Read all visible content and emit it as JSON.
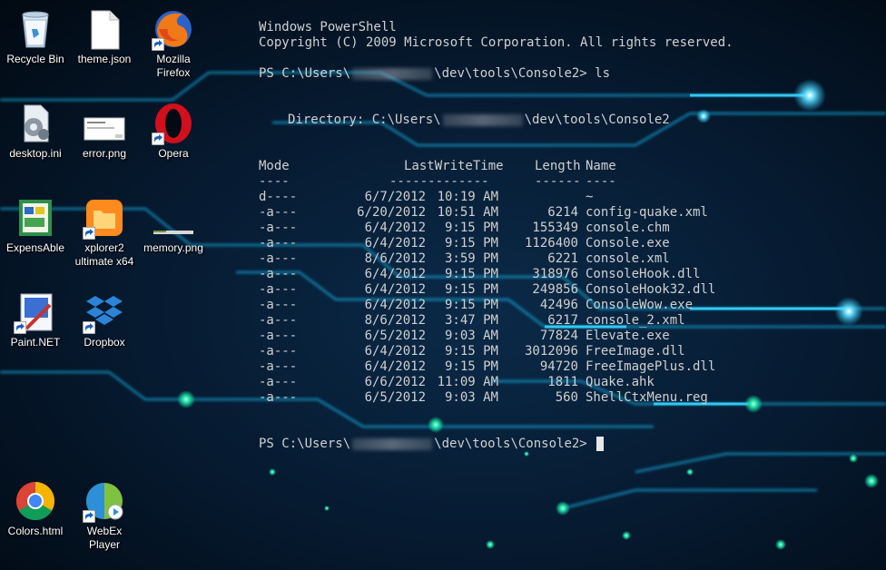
{
  "desktop": {
    "icons": [
      {
        "label": "Recycle Bin",
        "icon": "recycle-bin-icon"
      },
      {
        "label": "theme.json",
        "icon": "file-icon"
      },
      {
        "label": "Mozilla Firefox",
        "icon": "firefox-icon"
      },
      {
        "label": "desktop.ini",
        "icon": "settings-file-icon"
      },
      {
        "label": "error.png",
        "icon": "image-file-icon"
      },
      {
        "label": "Opera",
        "icon": "opera-icon"
      },
      {
        "label": "ExpensAble",
        "icon": "expensable-icon"
      },
      {
        "label": "xplorer2 ultimate x64",
        "icon": "xplorer2-icon"
      },
      {
        "label": "memory.png",
        "icon": "image-file-icon"
      },
      {
        "label": "Paint.NET",
        "icon": "paint-net-icon"
      },
      {
        "label": "Dropbox",
        "icon": "dropbox-icon"
      },
      {
        "label": "Colors.html",
        "icon": "chrome-icon"
      },
      {
        "label": "WebEx Player",
        "icon": "webex-player-icon"
      }
    ]
  },
  "console": {
    "header_title": "Windows PowerShell",
    "header_copyright": "Copyright (C) 2009 Microsoft Corporation. All rights reserved.",
    "prompt_prefix": "PS C:\\Users\\",
    "prompt_suffix": "\\dev\\tools\\Console2>",
    "command": "ls",
    "directory_prefix": "Directory: C:\\Users\\",
    "directory_suffix": "\\dev\\tools\\Console2",
    "columns": {
      "mode": "Mode",
      "time": "LastWriteTime",
      "length": "Length",
      "name": "Name"
    },
    "separators": {
      "mode": "----",
      "time": "-------------",
      "length": "------",
      "name": "----"
    },
    "rows": [
      {
        "mode": "d----",
        "date": "6/7/2012",
        "time": "10:19 AM",
        "length": "",
        "name": "~"
      },
      {
        "mode": "-a---",
        "date": "6/20/2012",
        "time": "10:51 AM",
        "length": "6214",
        "name": "config-quake.xml"
      },
      {
        "mode": "-a---",
        "date": "6/4/2012",
        "time": "9:15 PM",
        "length": "155349",
        "name": "console.chm"
      },
      {
        "mode": "-a---",
        "date": "6/4/2012",
        "time": "9:15 PM",
        "length": "1126400",
        "name": "Console.exe"
      },
      {
        "mode": "-a---",
        "date": "8/6/2012",
        "time": "3:59 PM",
        "length": "6221",
        "name": "console.xml"
      },
      {
        "mode": "-a---",
        "date": "6/4/2012",
        "time": "9:15 PM",
        "length": "318976",
        "name": "ConsoleHook.dll"
      },
      {
        "mode": "-a---",
        "date": "6/4/2012",
        "time": "9:15 PM",
        "length": "249856",
        "name": "ConsoleHook32.dll"
      },
      {
        "mode": "-a---",
        "date": "6/4/2012",
        "time": "9:15 PM",
        "length": "42496",
        "name": "ConsoleWow.exe"
      },
      {
        "mode": "-a---",
        "date": "8/6/2012",
        "time": "3:47 PM",
        "length": "6217",
        "name": "console_2.xml"
      },
      {
        "mode": "-a---",
        "date": "6/5/2012",
        "time": "9:03 AM",
        "length": "77824",
        "name": "Elevate.exe"
      },
      {
        "mode": "-a---",
        "date": "6/4/2012",
        "time": "9:15 PM",
        "length": "3012096",
        "name": "FreeImage.dll"
      },
      {
        "mode": "-a---",
        "date": "6/4/2012",
        "time": "9:15 PM",
        "length": "94720",
        "name": "FreeImagePlus.dll"
      },
      {
        "mode": "-a---",
        "date": "6/6/2012",
        "time": "11:09 AM",
        "length": "1811",
        "name": "Quake.ahk"
      },
      {
        "mode": "-a---",
        "date": "6/5/2012",
        "time": "9:03 AM",
        "length": "560",
        "name": "ShellCtxMenu.reg"
      }
    ]
  },
  "colors": {
    "background": "#020a14",
    "glow": "#1ec8ff",
    "dot_green": "#19d9a0",
    "text": "#d0d0d0"
  }
}
